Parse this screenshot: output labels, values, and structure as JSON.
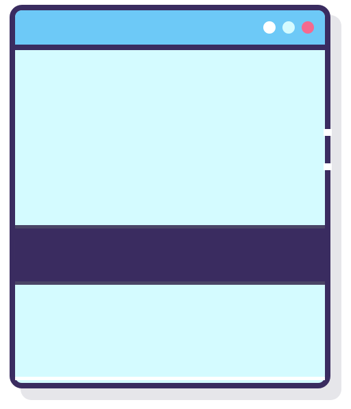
{
  "window_icon": {
    "semantic_name": "browser-window-icon",
    "controls": [
      {
        "name": "window-control-dot-1",
        "color": "#ffffff"
      },
      {
        "name": "window-control-dot-2",
        "color": "#d4fbff"
      },
      {
        "name": "window-close-dot",
        "color": "#f5698f"
      }
    ],
    "colors": {
      "outline": "#3a2c60",
      "title_bar": "#6dc9f7",
      "content": "#d4fbff",
      "band": "#3a2c60",
      "shadow": "#e6e6ea"
    }
  }
}
